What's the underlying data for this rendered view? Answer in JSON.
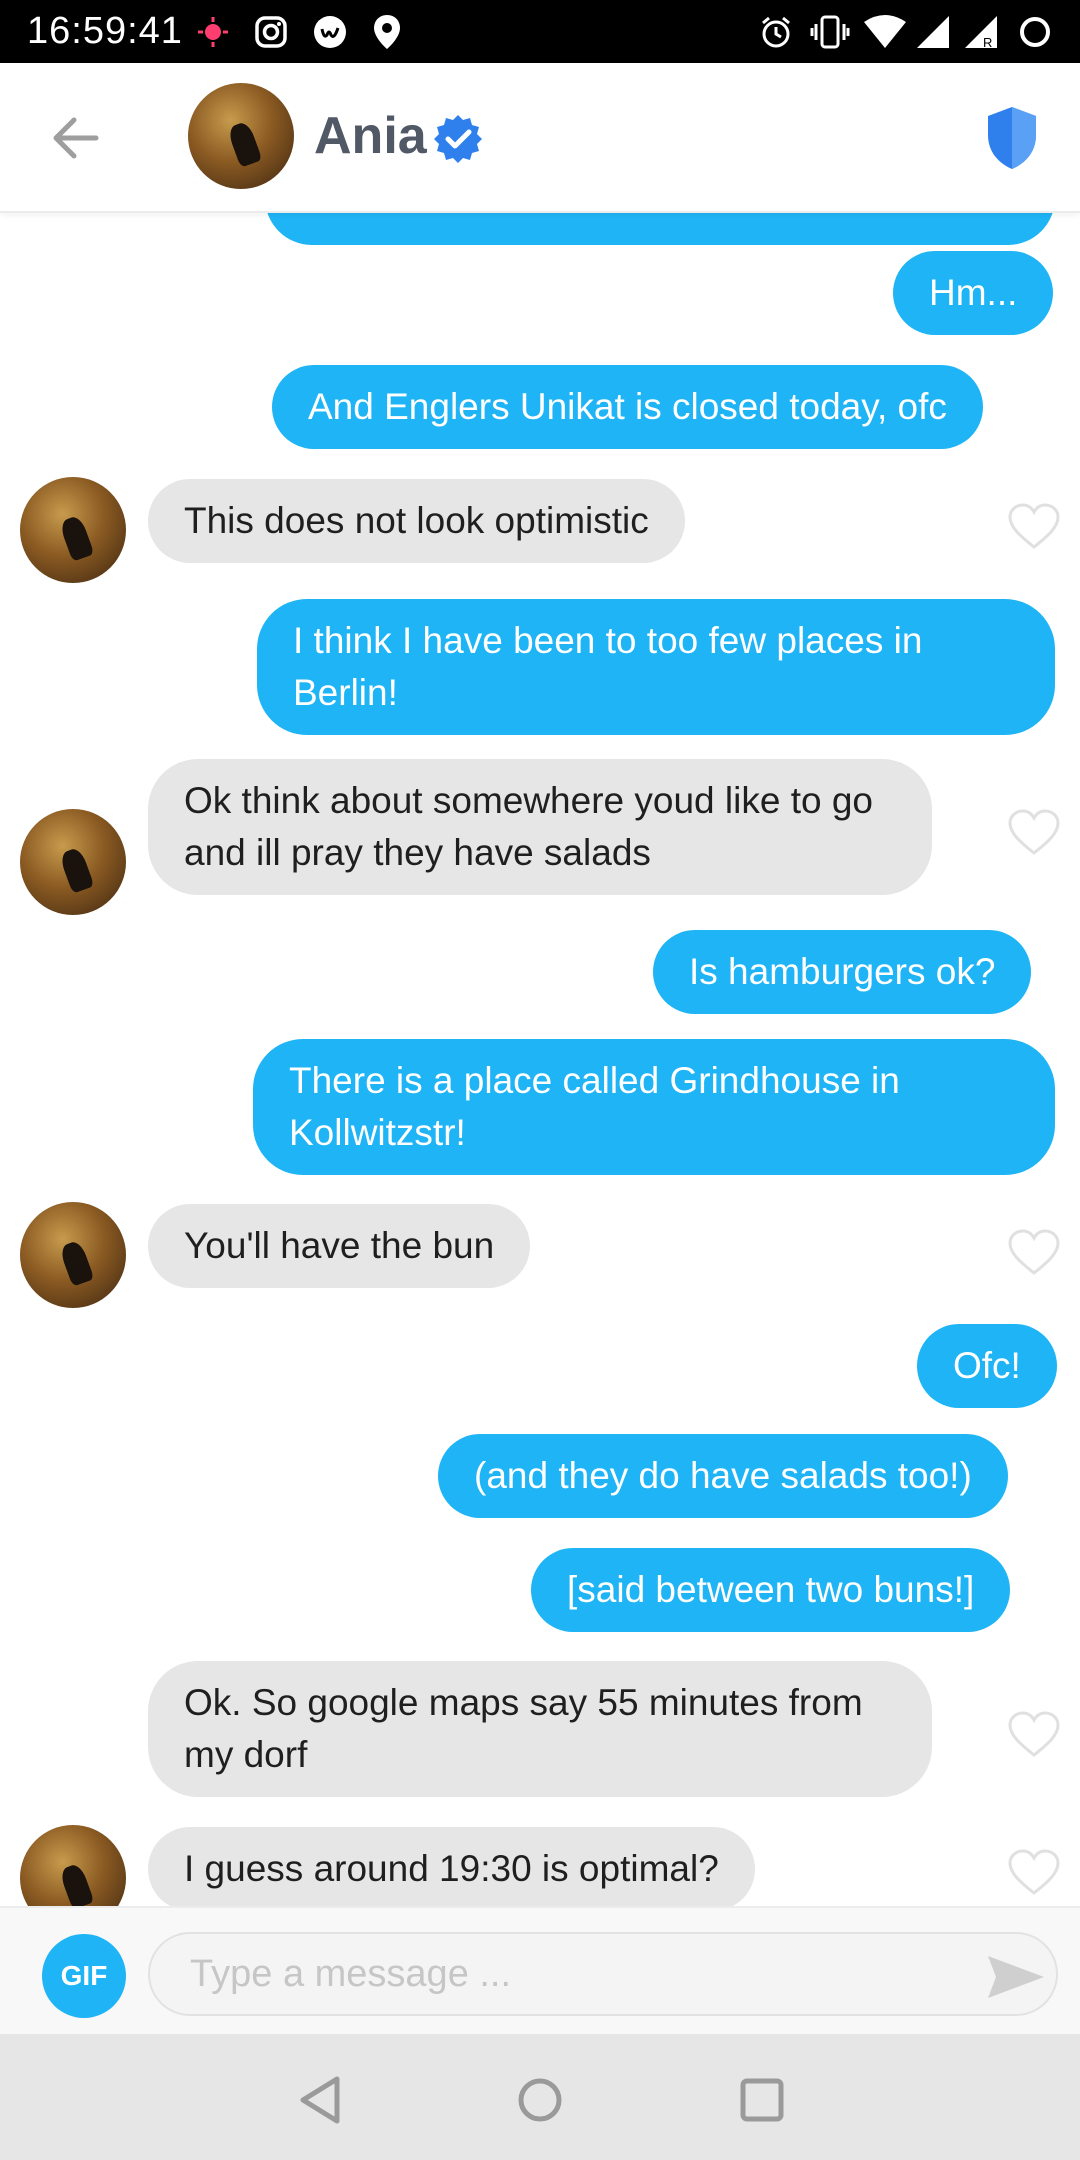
{
  "status_bar": {
    "time": "16:59:41",
    "icons": [
      "record-icon",
      "instagram-icon",
      "app-icon",
      "location-icon",
      "alarm-icon",
      "vibrate-icon",
      "wifi-icon",
      "signal-icon",
      "signal-roaming-icon",
      "battery-icon"
    ]
  },
  "header": {
    "contact_name": "Ania",
    "verified": true,
    "accent_color": "#2f80ed"
  },
  "messages": [
    {
      "from": "me",
      "text": "Hm..."
    },
    {
      "from": "me",
      "text": "And Englers Unikat is closed today, ofc"
    },
    {
      "from": "them",
      "text": "This does not look optimistic"
    },
    {
      "from": "me",
      "text": "I think I have been to too few places in Berlin!"
    },
    {
      "from": "them",
      "text": "Ok think about somewhere youd like to go and ill pray they have salads"
    },
    {
      "from": "me",
      "text": "Is hamburgers ok?"
    },
    {
      "from": "me",
      "text": "There is a place called Grindhouse in Kollwitzstr!"
    },
    {
      "from": "them",
      "text": "You'll have the bun"
    },
    {
      "from": "me",
      "text": "Ofc!"
    },
    {
      "from": "me",
      "text": "(and they do have salads too!)"
    },
    {
      "from": "me",
      "text": "[said between two buns!]"
    },
    {
      "from": "them",
      "text": "Ok. So google maps say 55 minutes from my dorf"
    },
    {
      "from": "them",
      "text": "I guess around 19:30 is optimal?"
    }
  ],
  "input": {
    "gif_label": "GIF",
    "placeholder": "Type a message ..."
  },
  "colors": {
    "outgoing_bubble": "#1eb4f6",
    "incoming_bubble": "#e6e6e6"
  }
}
